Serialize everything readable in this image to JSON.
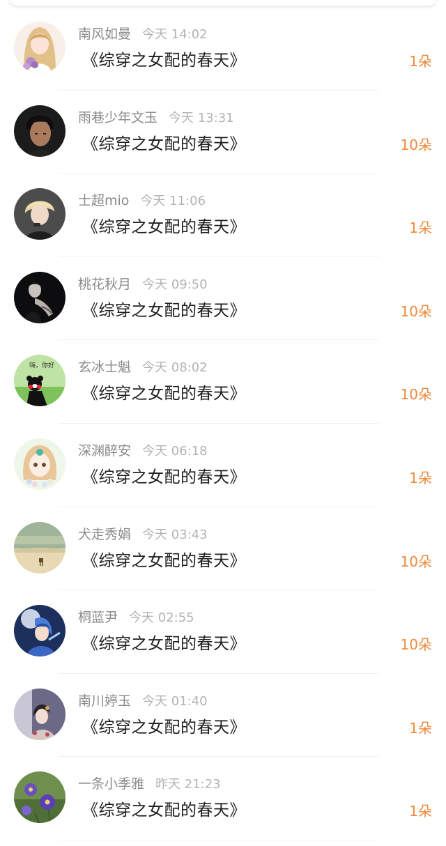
{
  "book_title": "《综穿之女配的春天》",
  "records": [
    {
      "username": "南风如曼",
      "time": "今天 14:02",
      "gift": "1朵",
      "avatar_icon": "anime-girl-avatar"
    },
    {
      "username": "雨巷少年文玉",
      "time": "今天 13:31",
      "gift": "10朵",
      "avatar_icon": "man-portrait-avatar"
    },
    {
      "username": "士超mio",
      "time": "今天 11:06",
      "gift": "1朵",
      "avatar_icon": "blond-singer-avatar"
    },
    {
      "username": "桃花秋月",
      "time": "今天 09:50",
      "gift": "10朵",
      "avatar_icon": "dark-figure-avatar"
    },
    {
      "username": "玄冰士魁",
      "time": "今天 08:02",
      "gift": "10朵",
      "avatar_icon": "bear-mascot-avatar"
    },
    {
      "username": "深渊醉安",
      "time": "今天 06:18",
      "gift": "1朵",
      "avatar_icon": "anime-doll-avatar"
    },
    {
      "username": "犬走秀娟",
      "time": "今天 03:43",
      "gift": "10朵",
      "avatar_icon": "landscape-avatar"
    },
    {
      "username": "桐蓝尹",
      "time": "今天 02:55",
      "gift": "10朵",
      "avatar_icon": "fantasy-warrior-avatar"
    },
    {
      "username": "南川婷玉",
      "time": "今天 01:40",
      "gift": "1朵",
      "avatar_icon": "costume-lady-avatar"
    },
    {
      "username": "一条小季雅",
      "time": "昨天 21:23",
      "gift": "1朵",
      "avatar_icon": "purple-flowers-avatar"
    }
  ],
  "colors": {
    "gift_accent": "#ee8a3c",
    "username": "#8a8a8a",
    "timestamp": "#b3b3b3",
    "title_text": "#1e1e1e"
  }
}
